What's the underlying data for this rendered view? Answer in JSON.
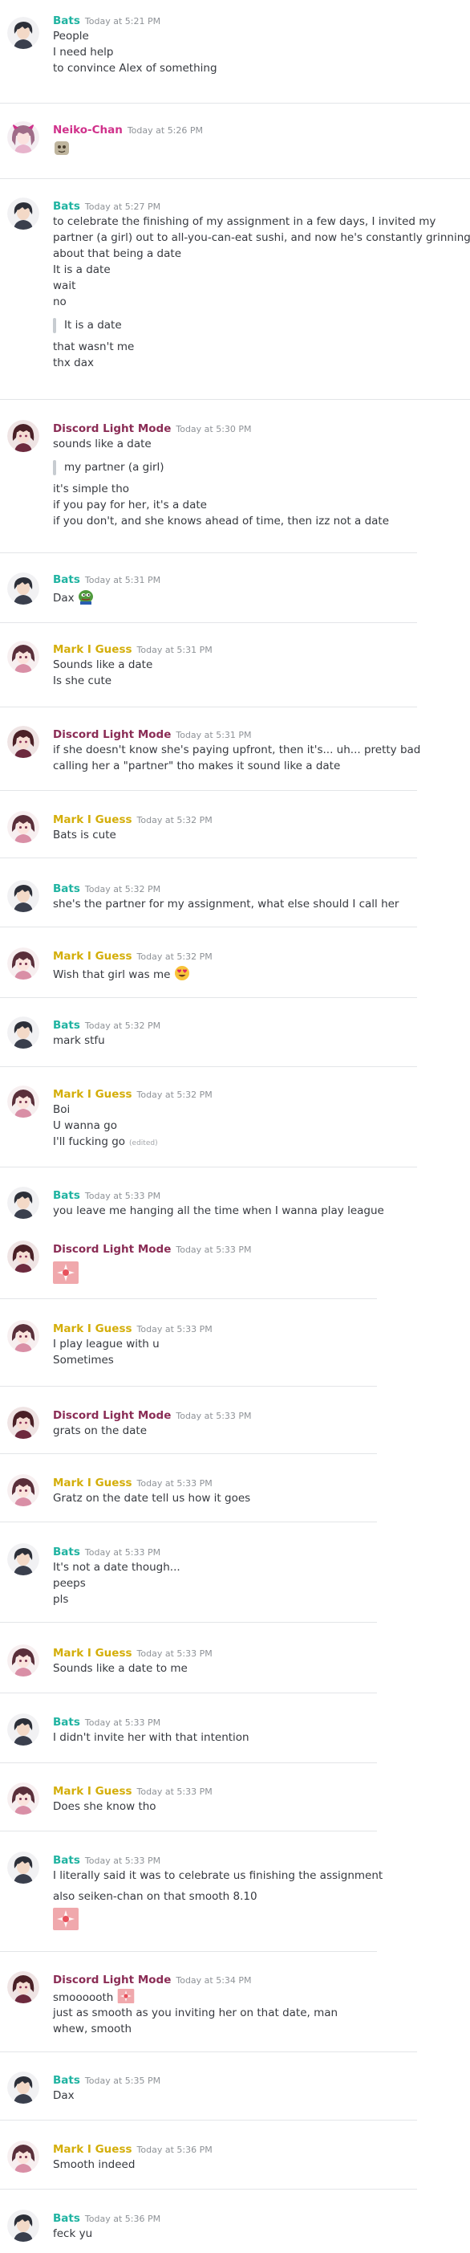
{
  "colors": {
    "bats": "#1fb3a1",
    "neiko": "#d0318b",
    "discord": "#8a2c55",
    "mark": "#d4ae0a",
    "timestamp": "#8e9297",
    "text": "#36393f"
  },
  "messages": [
    {
      "user": "Bats",
      "time": "Today at 5:21 PM",
      "lines": [
        "People",
        "I need help",
        "to convince Alex of something"
      ]
    },
    {
      "user": "Neiko-Chan",
      "time": "Today at 5:26 PM",
      "emoji": "small-creature-emoji"
    },
    {
      "user": "Bats",
      "time": "Today at 5:27 PM",
      "lines": [
        "to celebrate the finishing of my assignment in a few days, I invited my",
        "partner (a girl) out to all-you-can-eat sushi, and now he's constantly grinning",
        "about that being a date",
        "It is a date",
        "wait",
        "no"
      ],
      "quote": "It is a date",
      "after": [
        "that wasn't me",
        "thx dax"
      ]
    },
    {
      "user": "Discord Light Mode",
      "time": "Today at 5:30 PM",
      "lines": [
        "sounds like a date"
      ],
      "quote": "my partner (a girl)",
      "after": [
        "it's simple tho",
        "if you pay for her, it's a date",
        "if you don't, and she knows ahead of time, then izz not a date"
      ]
    },
    {
      "user": "Bats",
      "time": "Today at 5:31 PM",
      "lines": [
        "Dax"
      ],
      "emoji": "pepe-emoji"
    },
    {
      "user": "Mark I Guess",
      "time": "Today at 5:31 PM",
      "lines": [
        "Sounds like a date",
        "Is she cute"
      ]
    },
    {
      "user": "Discord Light Mode",
      "time": "Today at 5:31 PM",
      "lines": [
        "if she doesn't know she's paying upfront, then it's... uh... pretty bad",
        "calling her a \"partner\" tho makes it sound like a date"
      ]
    },
    {
      "user": "Mark I Guess",
      "time": "Today at 5:32 PM",
      "lines": [
        "Bats is cute"
      ]
    },
    {
      "user": "Bats",
      "time": "Today at 5:32 PM",
      "lines": [
        "she's the partner for my assignment, what else should I call her"
      ]
    },
    {
      "user": "Mark I Guess",
      "time": "Today at 5:32 PM",
      "lines": [
        "Wish that girl was me"
      ],
      "emoji": "heart-eyes-emoji"
    },
    {
      "user": "Bats",
      "time": "Today at 5:32 PM",
      "lines": [
        "mark stfu"
      ]
    },
    {
      "user": "Mark I Guess",
      "time": "Today at 5:32 PM",
      "lines": [
        "Boi",
        "U wanna go",
        "I'll fucking go"
      ],
      "edited": "(edited)"
    },
    {
      "user": "Bats",
      "time": "Today at 5:33 PM",
      "lines": [
        "you leave me hanging all the time when I wanna play league"
      ]
    },
    {
      "user": "Discord Light Mode",
      "time": "Today at 5:33 PM",
      "emoji": "sparkle-emoji"
    },
    {
      "user": "Mark I Guess",
      "time": "Today at 5:33 PM",
      "lines": [
        "I play league with u",
        "Sometimes"
      ]
    },
    {
      "user": "Discord Light Mode",
      "time": "Today at 5:33 PM",
      "lines": [
        "grats on the date"
      ]
    },
    {
      "user": "Mark I Guess",
      "time": "Today at 5:33 PM",
      "lines": [
        "Gratz on the date tell us how it goes"
      ]
    },
    {
      "user": "Bats",
      "time": "Today at 5:33 PM",
      "lines": [
        "It's not a date though...",
        "peeps",
        "pls"
      ]
    },
    {
      "user": "Mark I Guess",
      "time": "Today at 5:33 PM",
      "lines": [
        "Sounds like a date to me"
      ]
    },
    {
      "user": "Bats",
      "time": "Today at 5:33 PM",
      "lines": [
        "I didn't invite her with that intention"
      ]
    },
    {
      "user": "Mark I Guess",
      "time": "Today at 5:33 PM",
      "lines": [
        "Does she know tho"
      ]
    },
    {
      "user": "Bats",
      "time": "Today at 5:33 PM",
      "lines": [
        "I literally said it was to celebrate us finishing the assignment",
        "also seiken-chan on that smooth 8.10"
      ],
      "emoji": "sparkle-emoji"
    },
    {
      "user": "Discord Light Mode",
      "time": "Today at 5:34 PM",
      "lines": [
        "smoooooth",
        "just as smooth as you inviting her on that date, man",
        "whew, smooth"
      ],
      "emoji": "sparkle-emoji"
    },
    {
      "user": "Bats",
      "time": "Today at 5:35 PM",
      "lines": [
        "Dax"
      ]
    },
    {
      "user": "Mark I Guess",
      "time": "Today at 5:36 PM",
      "lines": [
        "Smooth indeed"
      ]
    },
    {
      "user": "Bats",
      "time": "Today at 5:36 PM",
      "lines": [
        "feck yu"
      ]
    }
  ]
}
